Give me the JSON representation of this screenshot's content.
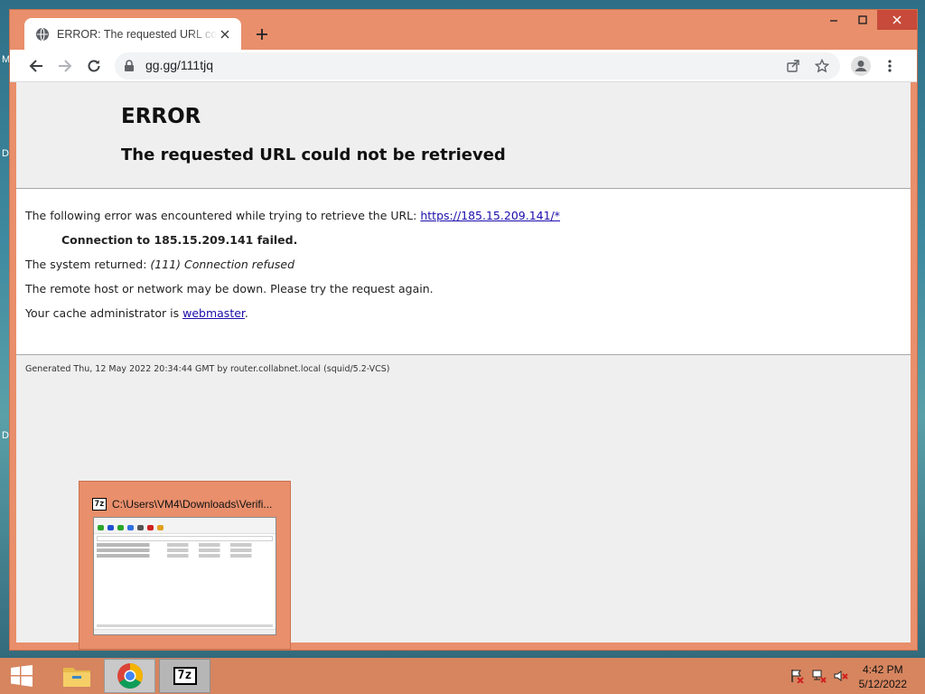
{
  "desktop": {
    "edge_labels": [
      "M",
      "D",
      "D"
    ]
  },
  "browser": {
    "tab": {
      "title": "ERROR: The requested URL could not be retrieved",
      "icon": "globe-icon"
    },
    "address": {
      "url": "gg.gg/111tjq"
    },
    "window_controls": {
      "minimize": "minimize-icon",
      "maximize": "maximize-icon",
      "close": "close-icon"
    }
  },
  "page": {
    "title": "ERROR",
    "subtitle": "The requested URL could not be retrieved",
    "intro_prefix": "The following error was encountered while trying to retrieve the URL: ",
    "intro_link": "https://185.15.209.141/*",
    "failure": "Connection to 185.15.209.141 failed.",
    "system_prefix": "The system returned: ",
    "system_message": "(111) Connection refused",
    "advice": "The remote host or network may be down. Please try the request again.",
    "admin_prefix": "Your cache administrator is ",
    "admin_link": "webmaster",
    "admin_suffix": ".",
    "footer": "Generated Thu, 12 May 2022 20:34:44 GMT by router.collabnet.local (squid/5.2-VCS)"
  },
  "preview": {
    "badge": "7z",
    "title": "C:\\Users\\VM4\\Downloads\\Verifi..."
  },
  "taskbar": {
    "apps": [
      {
        "name": "file-explorer",
        "icon": "folder-icon"
      },
      {
        "name": "chrome",
        "icon": "chrome-icon"
      },
      {
        "name": "7-zip",
        "icon": "7z-icon",
        "label": "7z"
      }
    ],
    "clock": {
      "time": "4:42 PM",
      "date": "5/12/2022"
    }
  },
  "colors": {
    "window_frame": "#e98f6c",
    "taskbar": "#d6855f",
    "link": "#1a0dab",
    "close_button": "#c74a3a"
  }
}
